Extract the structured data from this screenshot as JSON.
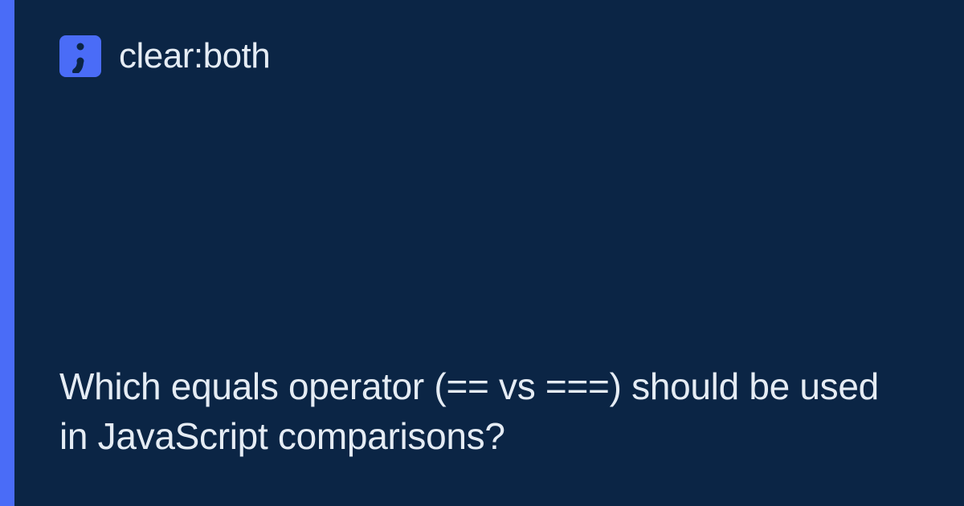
{
  "brand": {
    "name": "clear:both"
  },
  "title": "Which equals operator (== vs ===) should be used in JavaScript comparisons?",
  "colors": {
    "accent": "#4a6cf7",
    "background": "#0b2545",
    "text": "#e5ecf4"
  }
}
